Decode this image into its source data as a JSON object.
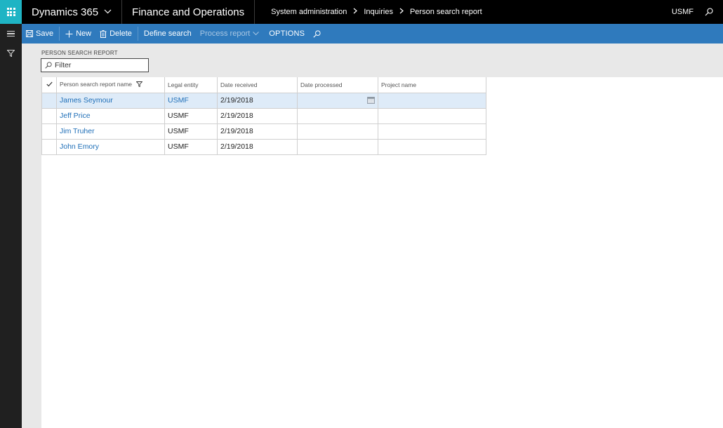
{
  "topbar": {
    "app_launcher_icon": "waffle-icon",
    "brand": "Dynamics 365",
    "brand_chevron_icon": "chevron-down-icon",
    "app_name": "Finance and Operations",
    "breadcrumb": [
      "System administration",
      "Inquiries",
      "Person search report"
    ],
    "breadcrumb_separator_icon": "chevron-right-icon",
    "company": "USMF",
    "search_icon": "search-icon"
  },
  "rail": {
    "items": [
      {
        "icon": "hamburger-icon"
      },
      {
        "icon": "filter-icon"
      }
    ]
  },
  "actionpane": {
    "save": "Save",
    "new": "New",
    "delete": "Delete",
    "define_search": "Define search",
    "process_report": "Process report",
    "options": "OPTIONS",
    "search_icon": "search-icon"
  },
  "page": {
    "section_label": "PERSON SEARCH REPORT",
    "filter_placeholder": "Filter"
  },
  "grid": {
    "columns": [
      "Person search report name",
      "Legal entity",
      "Date received",
      "Date processed",
      "Project name"
    ],
    "rows": [
      {
        "name": "James Seymour",
        "legal_entity": "USMF",
        "date_received": "2/19/2018",
        "date_processed": "",
        "project_name": "",
        "selected": true
      },
      {
        "name": "Jeff Price",
        "legal_entity": "USMF",
        "date_received": "2/19/2018",
        "date_processed": "",
        "project_name": "",
        "selected": false
      },
      {
        "name": "Jim Truher",
        "legal_entity": "USMF",
        "date_received": "2/19/2018",
        "date_processed": "",
        "project_name": "",
        "selected": false
      },
      {
        "name": "John Emory",
        "legal_entity": "USMF",
        "date_received": "2/19/2018",
        "date_processed": "",
        "project_name": "",
        "selected": false
      }
    ]
  },
  "colors": {
    "topbar": "#000000",
    "app_launcher": "#1fb4c4",
    "actionpane": "#2f7abd",
    "rail": "#202020",
    "link": "#1f6fb8",
    "selected_row": "#deebf8"
  }
}
